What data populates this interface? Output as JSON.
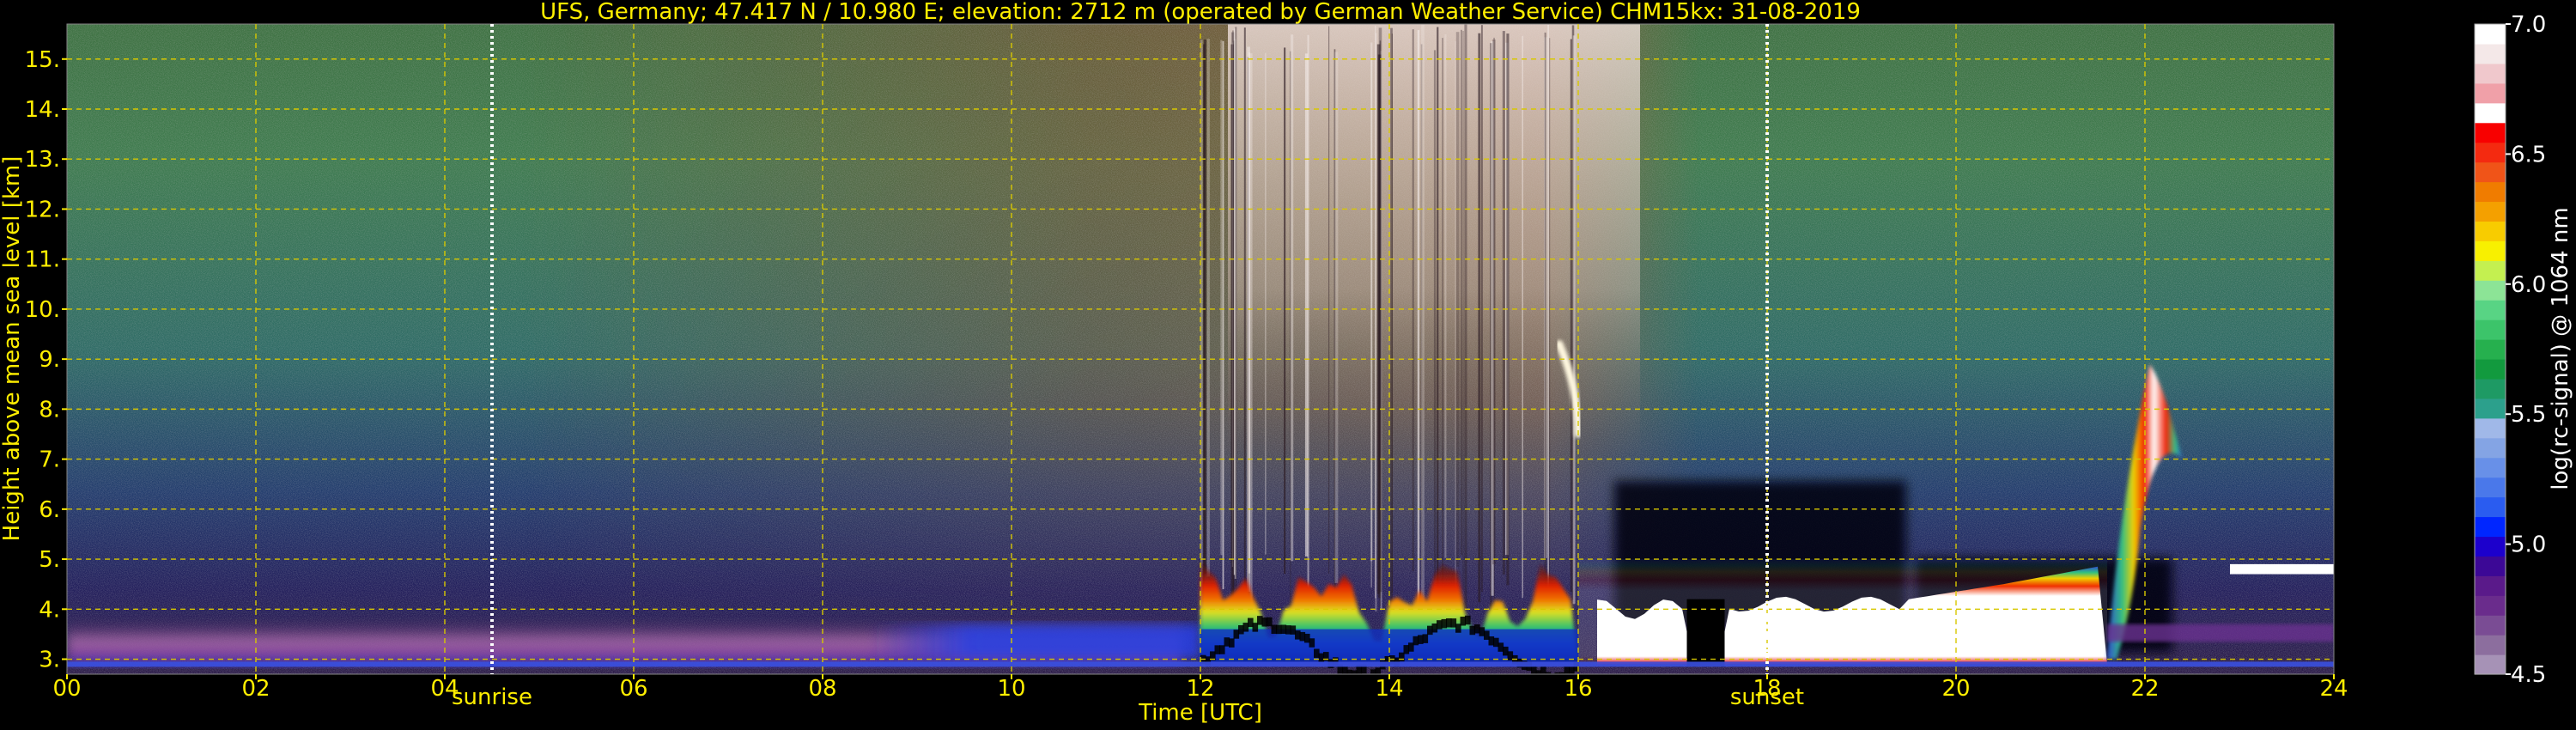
{
  "chart_data": {
    "type": "heatmap",
    "title": "UFS, Germany; 47.417 N / 10.980 E; elevation: 2712 m  (operated by German Weather Service)    CHM15kx: 31-08-2019",
    "xlabel": "Time [UTC]",
    "ylabel": "Height above mean sea level [km]",
    "xlim": [
      0,
      24
    ],
    "ylim": [
      2.7,
      15.7
    ],
    "x_ticks": [
      "00",
      "02",
      "04",
      "06",
      "08",
      "10",
      "12",
      "14",
      "16",
      "18",
      "20",
      "22",
      "24"
    ],
    "y_ticks": [
      "3.",
      "4.",
      "5.",
      "6.",
      "7.",
      "8.",
      "9.",
      "10.",
      "11.",
      "12.",
      "13.",
      "14.",
      "15."
    ],
    "grid": true,
    "annotations": [
      {
        "label": "sunrise",
        "x": 4.5
      },
      {
        "label": "sunset",
        "x": 18.0
      }
    ],
    "colorbar": {
      "label": "log(rc-signal) @ 1064 nm",
      "range": [
        4.5,
        7.0
      ],
      "ticks": [
        "4.5",
        "5.0",
        "5.5",
        "6.0",
        "6.5",
        "7.0"
      ],
      "colors": [
        "#a692b6",
        "#8c6e9e",
        "#7a4c94",
        "#6a2c8c",
        "#5a1a8a",
        "#3c0896",
        "#1c00cc",
        "#0026ff",
        "#2a5cf0",
        "#4a78ea",
        "#6890e8",
        "#84a4e4",
        "#a0b8e8",
        "#2ca08c",
        "#1e9a64",
        "#129a3e",
        "#26b04e",
        "#3cc46a",
        "#58d484",
        "#8ce496",
        "#c4f050",
        "#f8f000",
        "#f8cc00",
        "#f4a000",
        "#f07c00",
        "#f05418",
        "#f42a10",
        "#f80000",
        "#ffffff",
        "#f0a0a8",
        "#f0c8cc",
        "#f4e8e8",
        "#ffffff"
      ]
    },
    "features": [
      {
        "name": "background noise",
        "t_start": 0,
        "t_end": 24,
        "h_start": 4.5,
        "h_end": 15.7
      },
      {
        "name": "boundary layer",
        "t_start": 0,
        "t_end": 11.8,
        "h_start": 2.9,
        "h_end": 3.8
      },
      {
        "name": "convective layer",
        "t_start": 12.0,
        "t_end": 16.0,
        "h_start": 2.9,
        "h_end": 5.2
      },
      {
        "name": "cloud column",
        "t_start": 16.0,
        "t_end": 21.6,
        "h_start": 2.9,
        "h_end": 5.0
      },
      {
        "name": "cloud plume",
        "t_start": 21.6,
        "t_end": 22.4,
        "h_start": 3.0,
        "h_end": 8.9
      },
      {
        "name": "streak",
        "t_start": 15.8,
        "t_end": 16.0,
        "h_start": 7.5,
        "h_end": 9.3
      }
    ]
  }
}
